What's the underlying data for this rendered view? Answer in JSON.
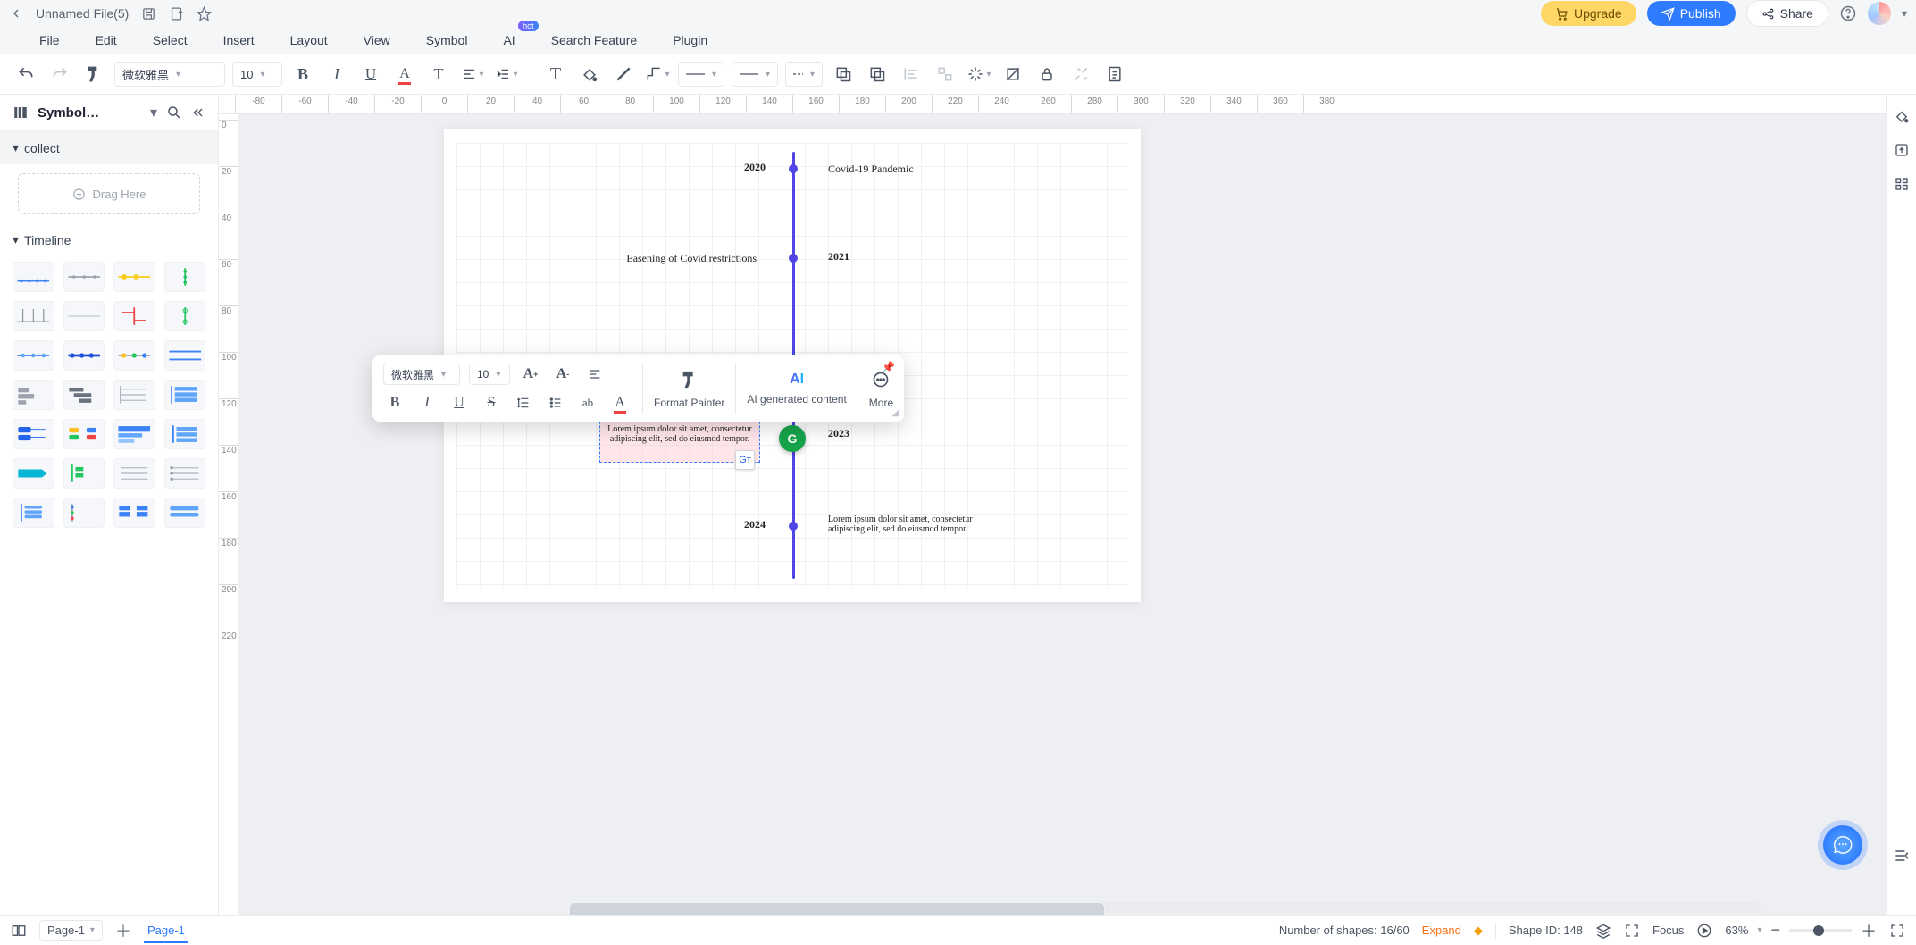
{
  "header": {
    "file_name": "Unnamed File(5)",
    "upgrade": "Upgrade",
    "publish": "Publish",
    "share": "Share"
  },
  "menu": {
    "items": [
      "File",
      "Edit",
      "Select",
      "Insert",
      "Layout",
      "View",
      "Symbol",
      "AI",
      "Search Feature",
      "Plugin"
    ]
  },
  "toolbar": {
    "font_family": "微软雅黑",
    "font_size": "10"
  },
  "left_panel": {
    "title": "Symbol…",
    "section_collect": "collect",
    "drag_here": "Drag Here",
    "section_timeline": "Timeline"
  },
  "ruler_h": [
    "-80",
    "-60",
    "-40",
    "-20",
    "0",
    "20",
    "40",
    "60",
    "80",
    "100",
    "120",
    "140",
    "160",
    "180",
    "200",
    "220",
    "240",
    "260",
    "280",
    "300",
    "320",
    "340",
    "360",
    "380"
  ],
  "ruler_v": [
    "0",
    "20",
    "40",
    "60",
    "80",
    "100",
    "120",
    "140",
    "160",
    "180",
    "200",
    "220"
  ],
  "timeline": {
    "n1_year": "2020",
    "n1_text": "Covid-19 Pandemic",
    "n2_year": "2021",
    "n2_text": "Easening of Covid restrictions",
    "n3_year": "2023",
    "n3_text": "Lorem ipsum dolor sit amet, consectetur adipiscing elit, sed do eiusmod tempor.",
    "n4_year": "2024",
    "n4_text": "Lorem ipsum dolor sit amet, consectetur adipiscing elit, sed do eiusmod tempor."
  },
  "float": {
    "font_family": "微软雅黑",
    "font_size": "10",
    "format_painter": "Format Painter",
    "ai_generated": "AI generated content",
    "more": "More"
  },
  "bottom": {
    "page_select": "Page-1",
    "page_tab": "Page-1",
    "shapes_label": "Number of shapes: 16/60",
    "expand": "Expand",
    "shape_id": "Shape ID: 148",
    "focus": "Focus",
    "zoom": "63%"
  }
}
